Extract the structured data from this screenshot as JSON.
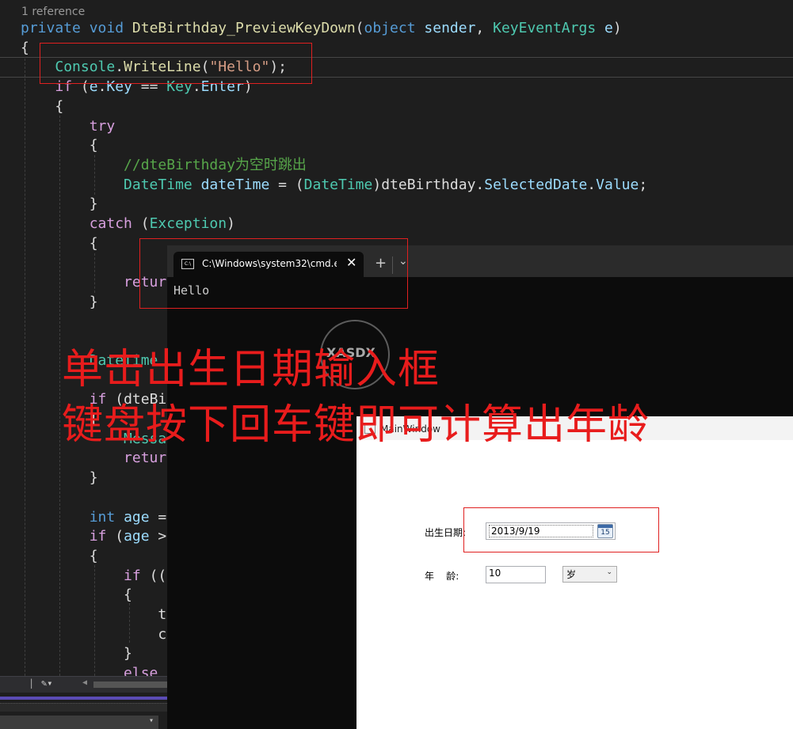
{
  "code": {
    "codelens": "1 reference",
    "lines": [
      {
        "tokens": [
          {
            "t": "private",
            "c": "kw"
          },
          {
            "t": " ",
            "c": "pl"
          },
          {
            "t": "void",
            "c": "kw"
          },
          {
            "t": " ",
            "c": "pl"
          },
          {
            "t": "DteBirthday_PreviewKeyDown",
            "c": "fn"
          },
          {
            "t": "(",
            "c": "pl"
          },
          {
            "t": "object",
            "c": "kw"
          },
          {
            "t": " ",
            "c": "pl"
          },
          {
            "t": "sender",
            "c": "id"
          },
          {
            "t": ", ",
            "c": "pl"
          },
          {
            "t": "KeyEventArgs",
            "c": "ty"
          },
          {
            "t": " ",
            "c": "pl"
          },
          {
            "t": "e",
            "c": "id"
          },
          {
            "t": ")",
            "c": "pl"
          }
        ]
      },
      {
        "tokens": [
          {
            "t": "{",
            "c": "pl"
          }
        ]
      },
      {
        "tokens": [
          {
            "t": "    ",
            "c": "pl"
          },
          {
            "t": "Console",
            "c": "ty"
          },
          {
            "t": ".",
            "c": "pl"
          },
          {
            "t": "WriteLine",
            "c": "fn"
          },
          {
            "t": "(",
            "c": "pl"
          },
          {
            "t": "\"Hello\"",
            "c": "str"
          },
          {
            "t": ");",
            "c": "pl"
          }
        ]
      },
      {
        "tokens": [
          {
            "t": "    ",
            "c": "pl"
          },
          {
            "t": "if",
            "c": "kw2"
          },
          {
            "t": " (",
            "c": "pl"
          },
          {
            "t": "e",
            "c": "id"
          },
          {
            "t": ".",
            "c": "pl"
          },
          {
            "t": "Key",
            "c": "id"
          },
          {
            "t": " == ",
            "c": "pl"
          },
          {
            "t": "Key",
            "c": "ty"
          },
          {
            "t": ".",
            "c": "pl"
          },
          {
            "t": "Enter",
            "c": "id"
          },
          {
            "t": ")",
            "c": "pl"
          }
        ]
      },
      {
        "tokens": [
          {
            "t": "    {",
            "c": "pl"
          }
        ]
      },
      {
        "tokens": [
          {
            "t": "        ",
            "c": "pl"
          },
          {
            "t": "try",
            "c": "kw2"
          }
        ]
      },
      {
        "tokens": [
          {
            "t": "        {",
            "c": "pl"
          }
        ]
      },
      {
        "tokens": [
          {
            "t": "            ",
            "c": "pl"
          },
          {
            "t": "//dteBirthday为空时跳出",
            "c": "cm"
          }
        ]
      },
      {
        "tokens": [
          {
            "t": "            ",
            "c": "pl"
          },
          {
            "t": "DateTime",
            "c": "ty"
          },
          {
            "t": " ",
            "c": "pl"
          },
          {
            "t": "dateTime",
            "c": "id"
          },
          {
            "t": " = (",
            "c": "pl"
          },
          {
            "t": "DateTime",
            "c": "ty"
          },
          {
            "t": ")dteBirthday.",
            "c": "pl"
          },
          {
            "t": "SelectedDate",
            "c": "id"
          },
          {
            "t": ".",
            "c": "pl"
          },
          {
            "t": "Value",
            "c": "id"
          },
          {
            "t": ";",
            "c": "pl"
          }
        ]
      },
      {
        "tokens": [
          {
            "t": "        }",
            "c": "pl"
          }
        ]
      },
      {
        "tokens": [
          {
            "t": "        ",
            "c": "pl"
          },
          {
            "t": "catch",
            "c": "kw2"
          },
          {
            "t": " (",
            "c": "pl"
          },
          {
            "t": "Exception",
            "c": "ty"
          },
          {
            "t": ")",
            "c": "pl"
          }
        ]
      },
      {
        "tokens": [
          {
            "t": "        {",
            "c": "pl"
          }
        ]
      },
      {
        "tokens": [
          {
            "t": "",
            "c": "pl"
          }
        ]
      },
      {
        "tokens": [
          {
            "t": "            ",
            "c": "pl"
          },
          {
            "t": "retur",
            "c": "kw2"
          }
        ]
      },
      {
        "tokens": [
          {
            "t": "        }",
            "c": "pl"
          }
        ]
      },
      {
        "tokens": [
          {
            "t": "",
            "c": "pl"
          }
        ]
      },
      {
        "tokens": [
          {
            "t": "",
            "c": "pl"
          }
        ]
      },
      {
        "tokens": [
          {
            "t": "        ",
            "c": "pl"
          },
          {
            "t": "DateTime",
            "c": "ty"
          }
        ]
      },
      {
        "tokens": [
          {
            "t": "",
            "c": "pl"
          }
        ]
      },
      {
        "tokens": [
          {
            "t": "        ",
            "c": "pl"
          },
          {
            "t": "if",
            "c": "kw2"
          },
          {
            "t": " (dteBi",
            "c": "pl"
          }
        ]
      },
      {
        "tokens": [
          {
            "t": "        {",
            "c": "pl"
          }
        ]
      },
      {
        "tokens": [
          {
            "t": "            ",
            "c": "pl"
          },
          {
            "t": "Messa",
            "c": "ty"
          }
        ]
      },
      {
        "tokens": [
          {
            "t": "            ",
            "c": "pl"
          },
          {
            "t": "retur",
            "c": "kw2"
          }
        ]
      },
      {
        "tokens": [
          {
            "t": "        }",
            "c": "pl"
          }
        ]
      },
      {
        "tokens": [
          {
            "t": "",
            "c": "pl"
          }
        ]
      },
      {
        "tokens": [
          {
            "t": "        ",
            "c": "pl"
          },
          {
            "t": "int",
            "c": "kw"
          },
          {
            "t": " ",
            "c": "pl"
          },
          {
            "t": "age",
            "c": "id"
          },
          {
            "t": " =",
            "c": "pl"
          }
        ]
      },
      {
        "tokens": [
          {
            "t": "        ",
            "c": "pl"
          },
          {
            "t": "if",
            "c": "kw2"
          },
          {
            "t": " (",
            "c": "pl"
          },
          {
            "t": "age",
            "c": "id"
          },
          {
            "t": " >",
            "c": "pl"
          }
        ]
      },
      {
        "tokens": [
          {
            "t": "        {",
            "c": "pl"
          }
        ]
      },
      {
        "tokens": [
          {
            "t": "            ",
            "c": "pl"
          },
          {
            "t": "if",
            "c": "kw2"
          },
          {
            "t": " ((",
            "c": "pl"
          }
        ]
      },
      {
        "tokens": [
          {
            "t": "            {",
            "c": "pl"
          }
        ]
      },
      {
        "tokens": [
          {
            "t": "                t",
            "c": "pl"
          }
        ]
      },
      {
        "tokens": [
          {
            "t": "                c",
            "c": "pl"
          }
        ]
      },
      {
        "tokens": [
          {
            "t": "            }",
            "c": "pl"
          }
        ]
      },
      {
        "tokens": [
          {
            "t": "            ",
            "c": "pl"
          },
          {
            "t": "else",
            "c": "kw2"
          }
        ]
      }
    ]
  },
  "terminal": {
    "tab_title": "C:\\Windows\\system32\\cmd.e:",
    "tab_icon_text": "C:\\",
    "close": "✕",
    "add": "+",
    "dropdown": "⌄",
    "output": "Hello"
  },
  "wpf": {
    "title": "MainWindow",
    "birth_label": "出生日期:",
    "birth_value": "2013/9/19",
    "cal_day": "15",
    "age_label": "年    龄:",
    "age_value": "10",
    "unit_value": "岁"
  },
  "overlay": {
    "line1": "单击出生日期输入框",
    "line2": "键盘按下回车键即可计算出年龄"
  },
  "watermark": "XASDX"
}
